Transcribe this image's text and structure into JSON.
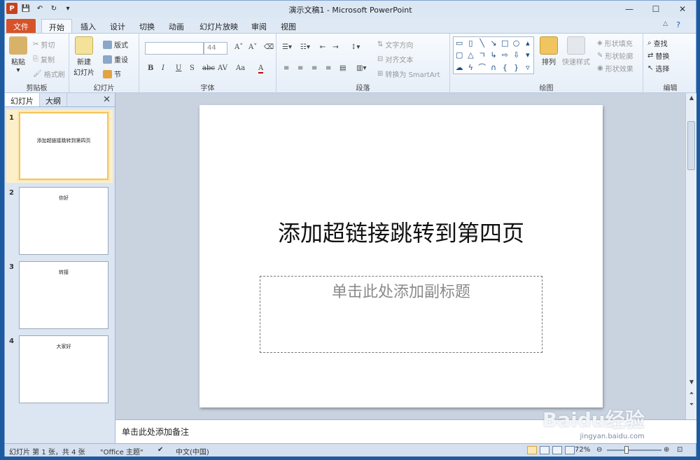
{
  "window": {
    "title": "演示文稿1 - Microsoft PowerPoint"
  },
  "qat": {
    "logo_letter": "P"
  },
  "tabs": [
    "文件",
    "开始",
    "插入",
    "设计",
    "切换",
    "动画",
    "幻灯片放映",
    "审阅",
    "视图"
  ],
  "ribbon": {
    "clipboard": {
      "label": "剪贴板",
      "paste": "粘贴",
      "cut": "剪切",
      "copy": "复制",
      "format_painter": "格式刷"
    },
    "slides": {
      "label": "幻灯片",
      "new_slide": "新建",
      "new_slide2": "幻灯片",
      "layout": "版式",
      "reset": "重设",
      "section": "节"
    },
    "font": {
      "label": "字体",
      "font_name": "",
      "font_size": "44",
      "bold": "B",
      "italic": "I",
      "underline": "U",
      "shadow": "S",
      "strike": "abc",
      "spacing": "AV",
      "case": "Aa",
      "color": "A"
    },
    "paragraph": {
      "label": "段落",
      "text_direction": "文字方向",
      "align_text": "对齐文本",
      "smartart": "转换为 SmartArt"
    },
    "drawing": {
      "label": "绘图",
      "arrange": "排列",
      "quick_styles": "快速样式",
      "shape_fill": "形状填充",
      "shape_outline": "形状轮廓",
      "shape_effects": "形状效果"
    },
    "editing": {
      "label": "编辑",
      "find": "查找",
      "replace": "替换",
      "select": "选择"
    }
  },
  "panel": {
    "tab_slides": "幻灯片",
    "tab_outline": "大纲",
    "thumbnails": [
      {
        "num": "1",
        "title": "添加超链接跳转到第四页"
      },
      {
        "num": "2",
        "title": "你好"
      },
      {
        "num": "3",
        "title": "转接"
      },
      {
        "num": "4",
        "title": "大家好"
      }
    ]
  },
  "slide": {
    "title": "添加超链接跳转到第四页",
    "subtitle_placeholder": "单击此处添加副标题"
  },
  "notes": {
    "placeholder": "单击此处添加备注"
  },
  "status": {
    "slide_info": "幻灯片 第 1 张，共 4 张",
    "theme": "\"Office 主题\"",
    "language": "中文(中国)",
    "zoom": "72%"
  },
  "watermark": {
    "brand": "Baidu经验",
    "site": "jingyan.baidu.com"
  },
  "colors": {
    "file_tab": "#d6532a",
    "accent": "#1c5fa6",
    "selected_thumb": "#f5c55a"
  }
}
